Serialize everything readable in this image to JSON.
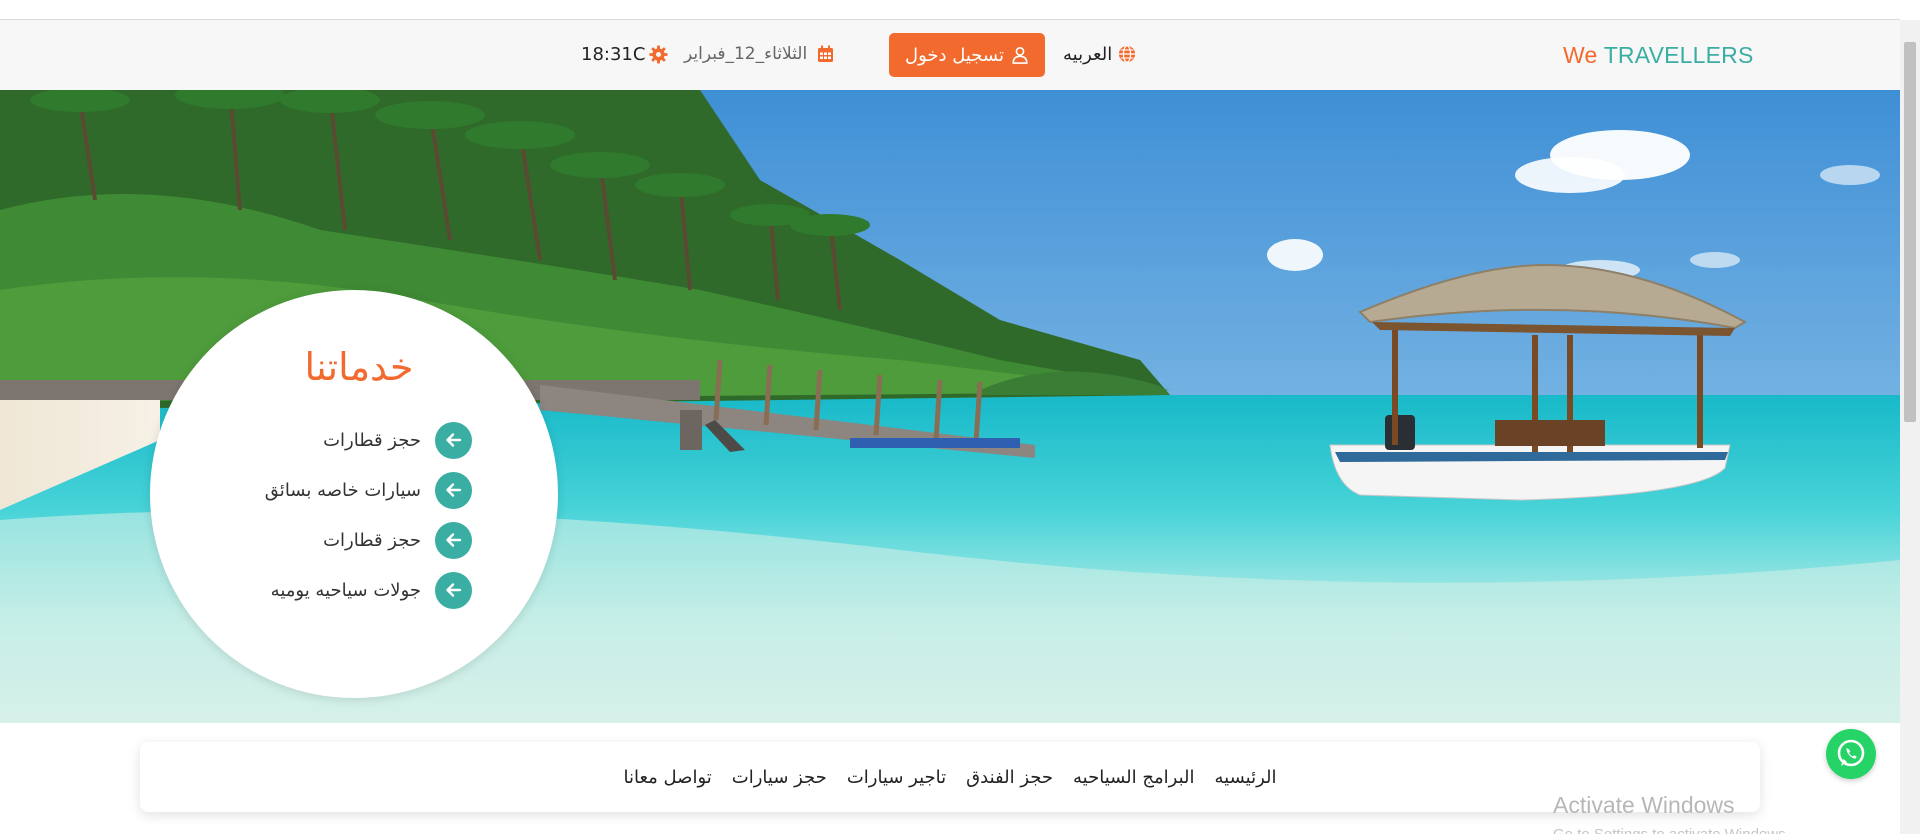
{
  "header": {
    "brand_we": "We",
    "brand_travellers": "TRAVELLERS",
    "language": "العربيه",
    "login_label": "تسجيل دخول",
    "date": "الثلاثاء_12_فبراير",
    "temperature": "18:31C"
  },
  "icons": {
    "language": "globe-icon",
    "login": "user-icon",
    "date": "calendar-icon",
    "temperature": "gear-icon",
    "service_arrow": "arrow-left-icon",
    "whatsapp": "whatsapp-icon"
  },
  "services": {
    "title": "خدماتنا",
    "items": [
      {
        "label": "حجز قطارات"
      },
      {
        "label": "سيارات خاصه بسائق"
      },
      {
        "label": "حجز قطارات"
      },
      {
        "label": "جولات سياحيه يوميه"
      }
    ]
  },
  "nav": {
    "items": [
      {
        "label": "الرئيسيه"
      },
      {
        "label": "البرامج السياحيه"
      },
      {
        "label": "حجز الفندق"
      },
      {
        "label": "تاجير سيارات"
      },
      {
        "label": "حجز سيارات"
      },
      {
        "label": "تواصل معانا"
      }
    ]
  },
  "watermark": {
    "title": "Activate Windows",
    "subtitle": "Go to Settings to activate Windows."
  },
  "colors": {
    "accent_orange": "#f26a2e",
    "accent_teal": "#3aaea2",
    "whatsapp_green": "#25d366"
  }
}
